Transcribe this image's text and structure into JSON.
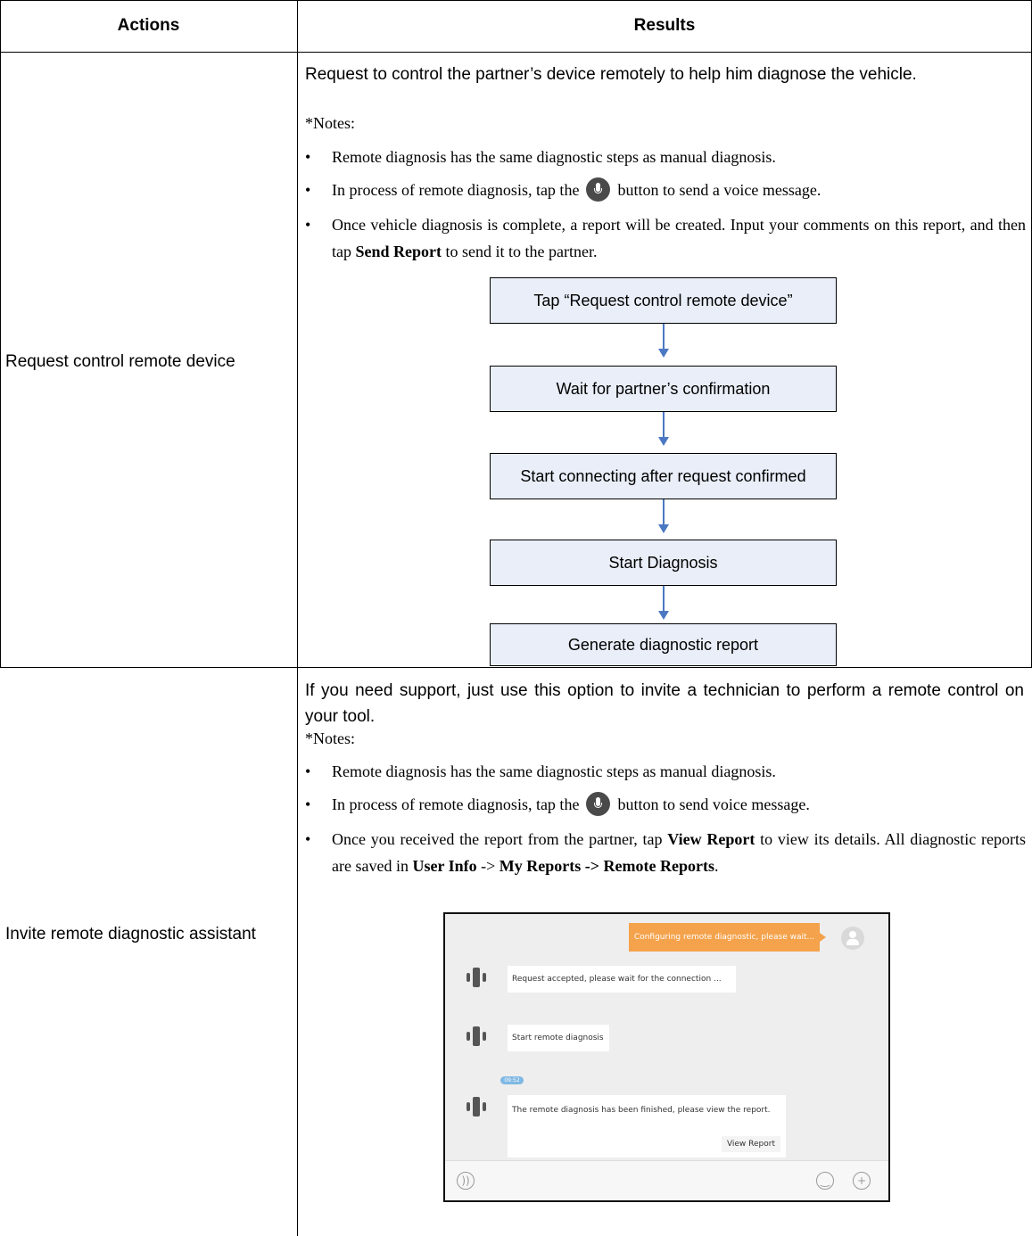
{
  "table": {
    "header_actions": "Actions",
    "header_results": "Results"
  },
  "row1": {
    "action": "Request control remote device",
    "intro": "Request to control the partner’s device remotely to help him diagnose the vehicle.",
    "notes_label": "*Notes:",
    "bullet1": "Remote diagnosis has the same diagnostic steps as manual diagnosis.",
    "bullet2_before": "In process of remote diagnosis, tap the",
    "bullet2_after": "button to send a voice message.",
    "bullet3_before": "Once vehicle diagnosis is complete, a report will be created. Input your comments on this report, and then tap",
    "bullet3_bold": "Send Report",
    "bullet3_after": "to send it to the partner.",
    "flow": [
      "Tap “Request control remote device”",
      "Wait for partner’s confirmation",
      "Start connecting after request confirmed",
      "Start Diagnosis",
      "Generate diagnostic report"
    ]
  },
  "row2": {
    "action": "Invite remote diagnostic assistant",
    "intro": "If you need support, just use this option to invite a technician to perform a remote control on your tool.",
    "notes_label": "*Notes:",
    "bullet1": "Remote diagnosis has the same diagnostic steps as manual diagnosis.",
    "bullet2_before": "In process of remote diagnosis, tap the",
    "bullet2_after": "button to send voice message.",
    "bullet3_p1": "Once you received the report from the partner, tap",
    "bullet3_b1": "View Report",
    "bullet3_p2": "to view its details. All diagnostic reports are saved in",
    "bullet3_b2": "User Info",
    "bullet3_p3": "->",
    "bullet3_b3": "My Reports -> Remote Reports",
    "bullet3_p4": ".",
    "bullet_symbol": "•"
  },
  "chat": {
    "outgoing": "Configuring remote diagnostic, please wait...",
    "msg1": "Request accepted, please wait for the connection ...",
    "msg2": "Start remote diagnosis",
    "time": "09:52",
    "msg3": "The remote diagnosis has been finished, please view the report.",
    "view_report": "View Report",
    "icons": [
      "voice-toggle-icon",
      "emoji-icon",
      "plus-icon"
    ],
    "accent_orange": "#f4a24b"
  }
}
